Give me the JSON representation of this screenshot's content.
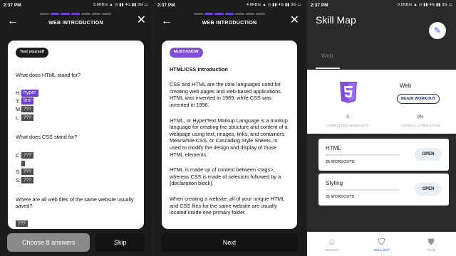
{
  "status_bars": [
    {
      "time": "2:37 PM",
      "right": "3.6KB/s ▲ ◷ ▮▮ 4G ▮▮ 3G ▭"
    },
    {
      "time": "2:37 PM",
      "right": "4.8KB/s ▲ ◷ ▮▮ 4G ▮▮ 3G ▭"
    },
    {
      "time": "2:37 PM",
      "right": "0.0KB/s ▲ ◷ ▮▮ 4G ▮▮ 3G ▭"
    }
  ],
  "quiz": {
    "header_title": "WEB INTRODUCTION",
    "chip": "Test yourself",
    "q1": "What does HTML stand for?",
    "q1_rows": [
      {
        "label": "H:",
        "value": "hyper",
        "type": "fill"
      },
      {
        "label": "T:",
        "value": "text",
        "type": "fill"
      },
      {
        "label": "M:",
        "value": "???",
        "type": "blank"
      },
      {
        "label": "L:",
        "value": "???",
        "type": "blank"
      }
    ],
    "q2": "What does CSS stand for?",
    "q2_rows": [
      {
        "label": "C:",
        "value": "???",
        "type": "blank"
      },
      {
        "label": "S:",
        "value": "???",
        "type": "blank"
      },
      {
        "label": "S:",
        "value": "???",
        "type": "blank"
      }
    ],
    "q3": "Where are all web files of the same website usually saved?",
    "q3_blank": "???",
    "choose_label": "Choose 8 answers",
    "skip_label": "Skip"
  },
  "lesson": {
    "header_title": "WEB INTRODUCTION",
    "chip": "MUST-KNOW",
    "heading": "HTML/CSS Introduction",
    "p1": "CSS and HTML are the core languages used for creating web pages and web-based applications. HTML was invented in 1989, while CSS was invented in 1996.",
    "p2": "HTML, or HyperText Markup Language is a markup language for creating the structure and content of a webpage using text, images, links, and containers. Meanwhile CSS, or Cascading Style Sheets, is used to modify the design and display of those HTML elements.",
    "p3": "HTML is made up of content between <tags>, whereas CSS is made of selectors followed by a {declaration block}.",
    "p4": "When creating a website, all of your unique HTML and CSS files for the same website are usually located inside one primary folder.",
    "next_label": "Next"
  },
  "skillmap": {
    "title": "Skill Map",
    "tab": "Web",
    "summary_title": "Web",
    "begin_label": "BEGIN WORKOUT",
    "completed_value": "0",
    "completed_caption": "COMPLETED WORKOUTS",
    "overall_value": "0%",
    "overall_caption": "OVERALL COMPLETION",
    "courses": [
      {
        "name": "HTML",
        "workouts": "26 WORKOUTS",
        "action": "OPEN"
      },
      {
        "name": "Styling",
        "workouts": "25 WORKOUTS",
        "action": "OPEN"
      }
    ],
    "nav": [
      {
        "label": "MISSION",
        "icon": "robot-icon"
      },
      {
        "label": "SKILL MAP",
        "icon": "skillmap-icon"
      },
      {
        "label": "TEAM",
        "icon": "team-icon"
      }
    ]
  }
}
